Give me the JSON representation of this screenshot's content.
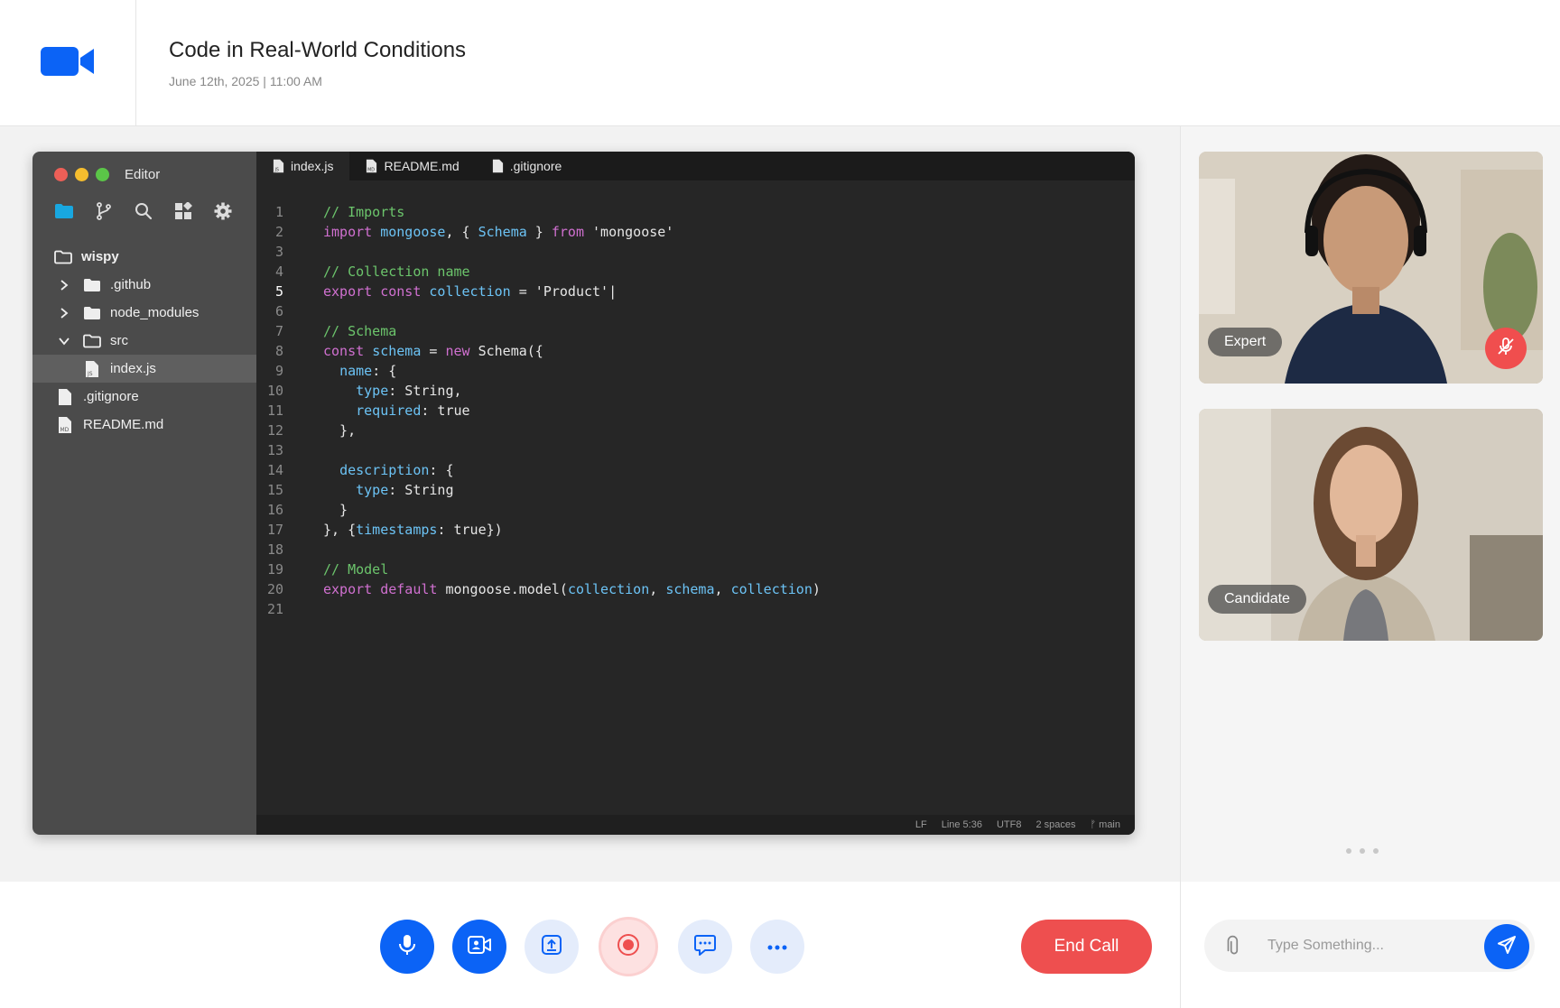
{
  "header": {
    "icon": "video-camera-icon",
    "title": "Code in Real-World Conditions",
    "subtitle": "June 12th, 2025 | 11:00 AM"
  },
  "colors": {
    "brand": "#0b63f6",
    "danger": "#ee4f4f",
    "editor_bg": "#262626",
    "editor_sidebar": "#4b4b4b"
  },
  "editor": {
    "title": "Editor",
    "sidebar_icons": [
      "folder-icon",
      "git-branch-icon",
      "search-icon",
      "extensions-icon",
      "settings-icon"
    ],
    "tree": [
      {
        "label": "wispy",
        "type": "root-folder",
        "level": 0
      },
      {
        "label": ".github",
        "type": "folder",
        "expanded": false,
        "level": 1
      },
      {
        "label": "node_modules",
        "type": "folder",
        "expanded": false,
        "level": 1
      },
      {
        "label": "src",
        "type": "folder",
        "expanded": true,
        "level": 1
      },
      {
        "label": "index.js",
        "type": "file-js",
        "selected": true,
        "level": 2
      },
      {
        "label": ".gitignore",
        "type": "file",
        "level": 0
      },
      {
        "label": "README.md",
        "type": "file-md",
        "level": 0
      }
    ],
    "tabs": [
      {
        "label": "index.js",
        "active": true
      },
      {
        "label": "README.md",
        "active": false
      },
      {
        "label": ".gitignore",
        "active": false
      }
    ],
    "current_line": 5,
    "code": [
      [
        [
          "c",
          "// Imports"
        ]
      ],
      [
        [
          "k",
          "import"
        ],
        [
          "t",
          " "
        ],
        [
          "v",
          "mongoose"
        ],
        [
          "t",
          ", { "
        ],
        [
          "v",
          "Schema"
        ],
        [
          "t",
          " } "
        ],
        [
          "k",
          "from"
        ],
        [
          "t",
          " 'mongoose'"
        ]
      ],
      [],
      [
        [
          "c",
          "// Collection name"
        ]
      ],
      [
        [
          "k",
          "export"
        ],
        [
          "t",
          " "
        ],
        [
          "k",
          "const"
        ],
        [
          "t",
          " "
        ],
        [
          "v",
          "collection"
        ],
        [
          "t",
          " = 'Product'|"
        ]
      ],
      [],
      [
        [
          "c",
          "// Schema"
        ]
      ],
      [
        [
          "k",
          "const"
        ],
        [
          "t",
          " "
        ],
        [
          "v",
          "schema"
        ],
        [
          "t",
          " = "
        ],
        [
          "k",
          "new"
        ],
        [
          "t",
          " Schema({"
        ]
      ],
      [
        [
          "t",
          "  "
        ],
        [
          "v",
          "name"
        ],
        [
          "t",
          ": {"
        ]
      ],
      [
        [
          "t",
          "    "
        ],
        [
          "v",
          "type"
        ],
        [
          "t",
          ": String,"
        ]
      ],
      [
        [
          "t",
          "    "
        ],
        [
          "v",
          "required"
        ],
        [
          "t",
          ": true"
        ]
      ],
      [
        [
          "t",
          "  },"
        ]
      ],
      [],
      [
        [
          "t",
          "  "
        ],
        [
          "v",
          "description"
        ],
        [
          "t",
          ": {"
        ]
      ],
      [
        [
          "t",
          "    "
        ],
        [
          "v",
          "type"
        ],
        [
          "t",
          ": String"
        ]
      ],
      [
        [
          "t",
          "  }"
        ]
      ],
      [
        [
          "t",
          "}, {"
        ],
        [
          "v",
          "timestamps"
        ],
        [
          "t",
          ": true})"
        ]
      ],
      [],
      [
        [
          "c",
          "// Model"
        ]
      ],
      [
        [
          "k",
          "export"
        ],
        [
          "t",
          " "
        ],
        [
          "k",
          "default"
        ],
        [
          "t",
          " mongoose.model("
        ],
        [
          "v",
          "collection"
        ],
        [
          "t",
          ", "
        ],
        [
          "v",
          "schema"
        ],
        [
          "t",
          ", "
        ],
        [
          "v",
          "collection"
        ],
        [
          "t",
          ")"
        ]
      ],
      []
    ],
    "token_colors": {
      "c": "#6cc56c",
      "k": "#d070d0",
      "v": "#6cc3f5",
      "t": "#e6e6e6"
    },
    "status": {
      "eol": "LF",
      "position": "Line 5:36",
      "encoding": "UTF8",
      "indent": "2 spaces",
      "branch": "ᚠ main"
    }
  },
  "participants": [
    {
      "label": "Expert",
      "muted": true
    },
    {
      "label": "Candidate",
      "muted": false
    }
  ],
  "controls": [
    {
      "name": "microphone-button",
      "icon": "microphone-icon"
    },
    {
      "name": "camera-button",
      "icon": "video-camera-icon"
    },
    {
      "name": "share-screen-button",
      "icon": "share-screen-icon"
    },
    {
      "name": "record-button",
      "icon": "record-icon"
    },
    {
      "name": "chat-button",
      "icon": "chat-icon"
    },
    {
      "name": "more-button",
      "icon": "more-icon"
    }
  ],
  "end_call_label": "End Call",
  "chat": {
    "placeholder": "Type Something..."
  }
}
